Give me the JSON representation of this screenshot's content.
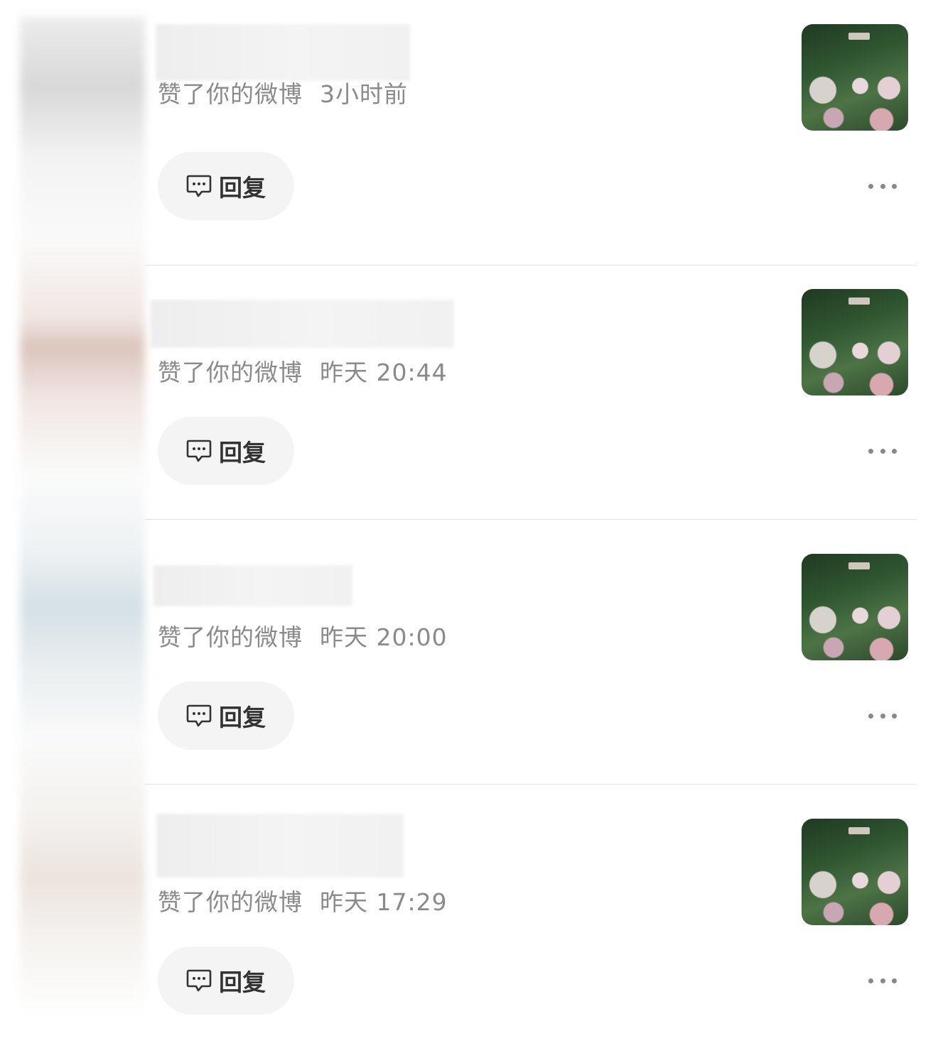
{
  "notifications": [
    {
      "action": "赞了你的微博",
      "time": "3小时前",
      "reply_label": "回复"
    },
    {
      "action": "赞了你的微博",
      "time": "昨天 20:44",
      "reply_label": "回复"
    },
    {
      "action": "赞了你的微博",
      "time": "昨天 20:00",
      "reply_label": "回复"
    },
    {
      "action": "赞了你的微博",
      "time": "昨天 17:29",
      "reply_label": "回复"
    }
  ],
  "icons": {
    "reply": "comment-bubble-icon",
    "more": "more-dots-icon"
  },
  "colors": {
    "meta_text": "#8a8a8a",
    "reply_bg": "#f4f4f4",
    "divider": "#e3e3e3"
  }
}
